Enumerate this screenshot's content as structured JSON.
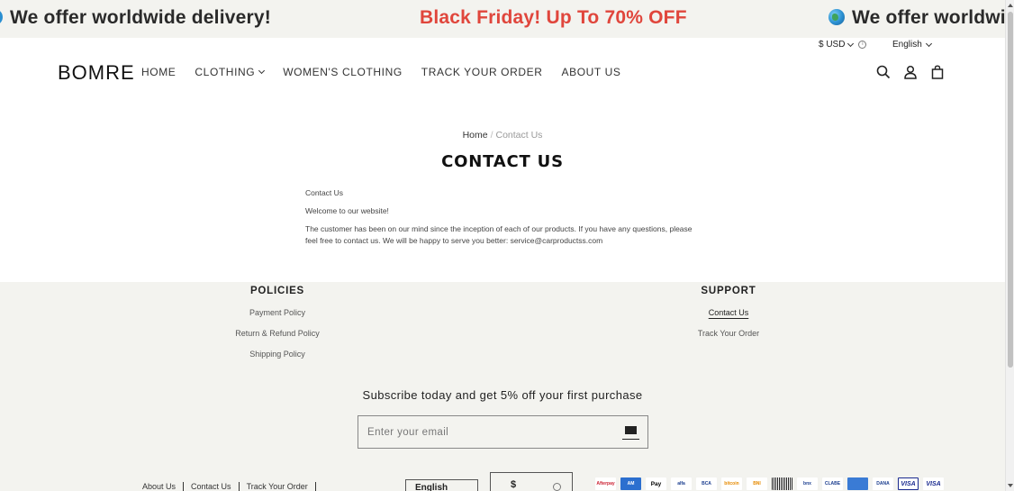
{
  "announcement": {
    "messages": [
      "We offer worldwide delivery!",
      "Black Friday! Up To 70% OFF",
      "We offer worldwide"
    ]
  },
  "header": {
    "currency": "$ USD",
    "language": "English",
    "logo": "BOMRE",
    "nav": [
      "HOME",
      "CLOTHING",
      "WOMEN'S CLOTHING",
      "TRACK YOUR ORDER",
      "ABOUT US"
    ]
  },
  "breadcrumb": {
    "home": "Home",
    "separator": "/",
    "current": "Contact Us"
  },
  "page": {
    "title": "CONTACT US",
    "paragraphs": [
      "Contact Us",
      "Welcome to our website!",
      "The customer has been on our mind since the inception of each of our products. If you have any questions, please feel free to contact us. We will be happy to serve you better: service@carproductss.com"
    ]
  },
  "footer": {
    "policies": {
      "title": "POLICIES",
      "links": [
        "Payment Policy",
        "Return & Refund Policy",
        "Shipping Policy"
      ]
    },
    "support": {
      "title": "SUPPORT",
      "links": [
        "Contact Us",
        "Track Your Order"
      ]
    },
    "subscribe_text": "Subscribe today and get 5% off your first purchase",
    "email_placeholder": "Enter your email",
    "bottom_links": [
      "About Us",
      "Contact Us",
      "Track Your Order"
    ],
    "language_select": "English",
    "currency_select": "$",
    "payment_icons": [
      "afterpay",
      "amex",
      "apple-pay",
      "alfamart",
      "bca",
      "bitcoin",
      "bni",
      "barcode",
      "banamex",
      "clabe",
      "card",
      "dana",
      "visa",
      "visa"
    ]
  }
}
